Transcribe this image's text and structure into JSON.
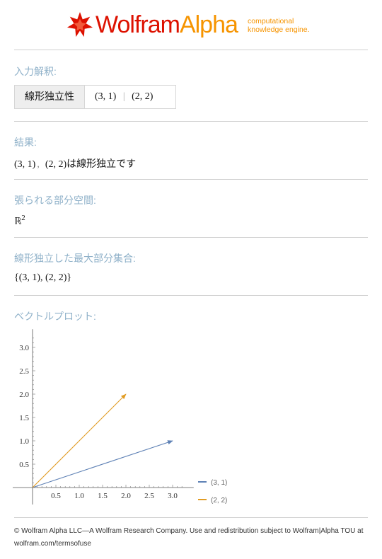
{
  "header": {
    "logo_wolfram": "Wolfram",
    "logo_alpha": "Alpha",
    "tagline_line1": "computational",
    "tagline_line2": "knowledge engine."
  },
  "pods": {
    "input": {
      "title": "入力解釈:",
      "label": "線形独立性",
      "vec1": "(3, 1)",
      "separator": "|",
      "vec2": "(2, 2)"
    },
    "result": {
      "title": "結果:",
      "vec1": "(3, 1)",
      "comma": ",",
      "vec2": "(2, 2)",
      "text": "は線形独立です"
    },
    "span": {
      "title": "張られる部分空間:",
      "symbol": "ℝ",
      "exponent": "2"
    },
    "max_subset": {
      "title": "線形独立した最大部分集合:",
      "value": "{(3, 1), (2, 2)}"
    },
    "plot": {
      "title": "ベクトルプロット:"
    }
  },
  "chart_data": {
    "type": "line",
    "xlim": [
      0,
      3.3
    ],
    "ylim": [
      0,
      3.3
    ],
    "x_ticks": [
      "0.5",
      "1.0",
      "1.5",
      "2.0",
      "2.5",
      "3.0"
    ],
    "y_ticks": [
      "0.5",
      "1.0",
      "1.5",
      "2.0",
      "2.5",
      "3.0"
    ],
    "grid": false,
    "legend_position": "bottom-right",
    "series": [
      {
        "name": "(3, 1)",
        "color": "#5e81b5",
        "x": [
          0,
          3
        ],
        "y": [
          0,
          1
        ]
      },
      {
        "name": "(2, 2)",
        "color": "#e19c24",
        "x": [
          0,
          2
        ],
        "y": [
          0,
          2
        ]
      }
    ]
  },
  "footer": {
    "text": "© Wolfram Alpha LLC—A Wolfram Research Company. Use and redistribution subject to Wolfram|Alpha TOU at wolfram.com/termsofuse"
  }
}
